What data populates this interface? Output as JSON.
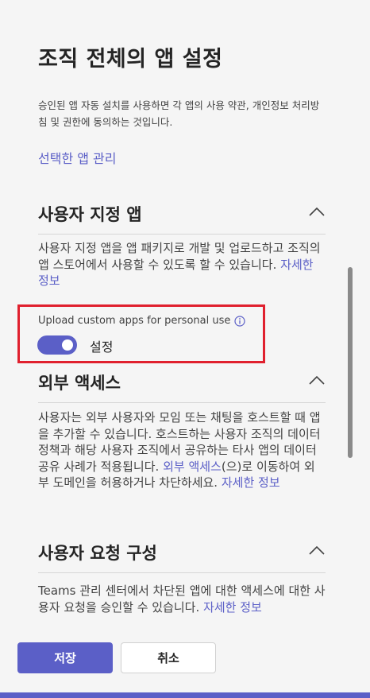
{
  "page": {
    "title": "조직 전체의 앱 설정",
    "intro": "승인된 앱 자동 설치를 사용하면 각 앱의 사용 약관, 개인정보 처리방침 및 권한에 동의하는 것입니다.",
    "manage_link": "선택한 앱 관리"
  },
  "sections": [
    {
      "title": "사용자 지정 앱",
      "body": "사용자 지정 앱을 앱 패키지로 개발 및 업로드하고 조직의 앱 스토어에서 사용할 수 있도록 할 수 있습니다.",
      "learn_more": "자세한 정보",
      "setting": {
        "label": "Upload custom apps for personal use",
        "toggle_state": "설정",
        "enabled": true
      }
    },
    {
      "title": "외부 액세스",
      "body_part1": "사용자는 외부 사용자와 모임 또는 채팅을 호스트할 때 앱을 추가할 수 있습니다. 호스트하는 사용자 조직의 데이터 정책과 해당 사용자 조직에서 공유하는 타사 앱의 데이터 공유 사례가 적용됩니다.",
      "inline_link": "외부 액세스",
      "body_part2": "(으)로 이동하여 외부 도메인을 허용하거나 차단하세요.",
      "learn_more": "자세한 정보"
    },
    {
      "title": "사용자 요청 구성",
      "body": "Teams 관리 센터에서 차단된 앱에 대한 액세스에 대한 사용자 요청을 승인할 수 있습니다.",
      "learn_more": "자세한 정보"
    }
  ],
  "footer": {
    "save_label": "저장",
    "cancel_label": "취소"
  },
  "colors": {
    "accent": "#5b5fc7",
    "highlight_border": "#e0202e",
    "background": "#f5f5f5"
  }
}
